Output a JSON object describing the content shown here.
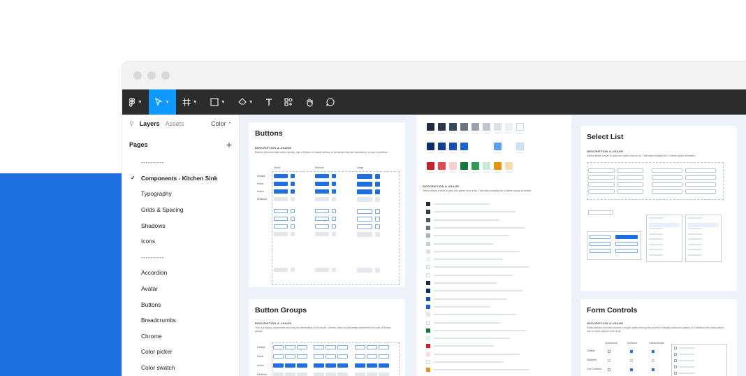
{
  "toolbar": {
    "figma_menu": "figma-logo-icon",
    "move_tool": "cursor-icon",
    "frame_tool": "frame-icon",
    "shape_tool": "rectangle-icon",
    "pen_tool": "pen-icon",
    "text_tool": "T",
    "components_tool": "components-icon",
    "hand_tool": "hand-icon",
    "comment_tool": "comment-icon",
    "active_color": "#0d99ff"
  },
  "sidebar": {
    "tab_layers": "Layers",
    "tab_assets": "Assets",
    "color_dropdown": "Color",
    "pages_title": "Pages",
    "pages": [
      "----------",
      "Components - Kitchen Sink",
      "Typography",
      "Grids & Spacing",
      "Shadows",
      "Icons",
      "----------",
      "Accordion",
      "Avatar",
      "Buttons",
      "Breadcrumbs",
      "Chrome",
      "Color picker",
      "Color swatch"
    ],
    "current_page_index": 1
  },
  "cards": {
    "buttons": {
      "title": "Buttons",
      "desc_head": "DESCRIPTION & USAGE",
      "desc": "Buttons let users take action quickly. Use a Button to enable actions or decisions that are important to a user's workflow.",
      "sizes": [
        "Small",
        "Medium",
        "Large"
      ],
      "states": [
        "Default",
        "Hover",
        "Active",
        "Disabled"
      ]
    },
    "button_groups": {
      "title": "Button Groups",
      "desc_head": "DESCRIPTION & USAGE",
      "desc": "This is a legacy component and may be deprecated in the future. Generic data not presently recommend the use of Button groups.",
      "states": [
        "Default",
        "Hover",
        "Active",
        "Disabled"
      ]
    },
    "colors": {
      "desc_head": "DESCRIPTION & USAGE",
      "desc": "Select allows a user to pick one option from a list. This helps simplify the UI when space is limited."
    },
    "select_list": {
      "title": "Select List",
      "desc_head": "DESCRIPTION & USAGE",
      "desc": "Select allows a user to pick one option from a list. This helps simplify the UI when space is limited."
    },
    "form_controls": {
      "title": "Form Controls",
      "desc_head": "DESCRIPTION & USAGE",
      "desc": "Radio buttons let users choose a single option among two or more mutually exclusive options. A Checkbox lets users select one or more options from a list.",
      "columns": [
        "Unchecked",
        "Checked",
        "Indeterminate"
      ],
      "states": [
        "Default",
        "Disabled",
        "Low Contrast"
      ]
    }
  }
}
